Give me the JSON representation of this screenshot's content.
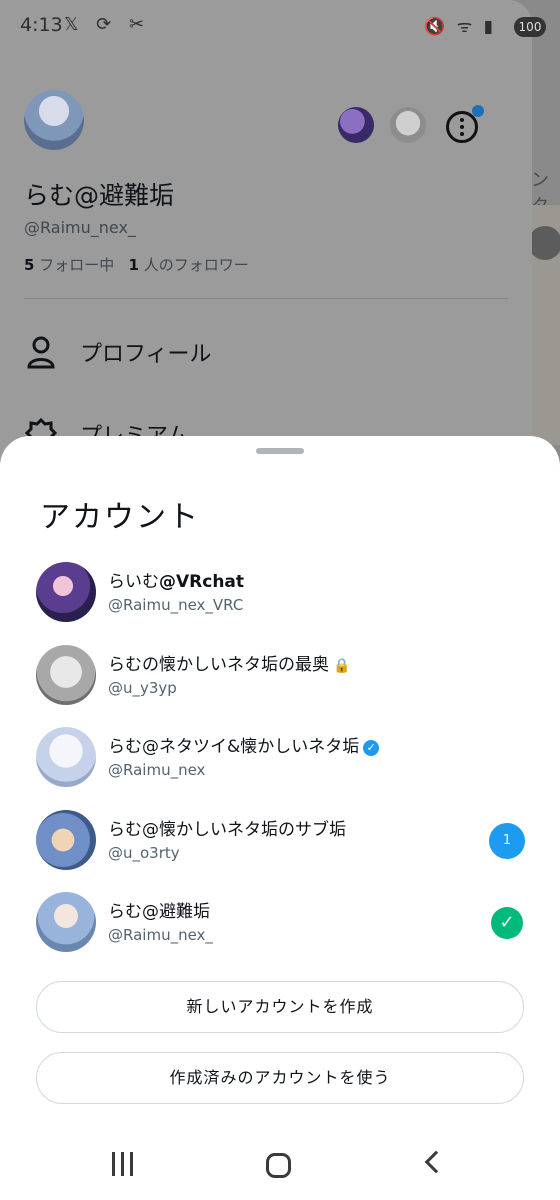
{
  "status_bar": {
    "time": "4:13",
    "left_icons": "𝕏 ⟳ ✂",
    "right_icons": "🔇 ᯤ ▮",
    "battery": "100"
  },
  "drawer": {
    "display_name": "らむ@避難垢",
    "handle": "@Raimu_nex_",
    "following_count": "5",
    "following_label": "フォロー中",
    "followers_count": "1",
    "followers_label": "人のフォロワー",
    "menu": [
      {
        "label": "プロフィール",
        "icon": "person-icon"
      },
      {
        "label": "プレミアム",
        "icon": "premium-icon"
      }
    ]
  },
  "background": {
    "partial_text": "ンタ"
  },
  "sheet": {
    "title": "アカウント",
    "accounts": [
      {
        "name_pre": "らいむ",
        "name_bold": "@VRchat",
        "handle": "@Raimu_nex_VRC"
      },
      {
        "name": "らむの懐かしいネタ垢の最奥",
        "lock": "🔒",
        "handle": "@u_y3yp"
      },
      {
        "name": "らむ@ネタツイ&懐かしいネタ垢",
        "verified": "✓",
        "handle": "@Raimu_nex"
      },
      {
        "name": "らむ@懐かしいネタ垢のサブ垢",
        "handle": "@u_o3rty",
        "badge": "1"
      },
      {
        "name": "らむ@避難垢",
        "handle": "@Raimu_nex_",
        "check": "✓"
      }
    ],
    "create_button": "新しいアカウントを作成",
    "use_existing_button": "作成済みのアカウントを使う"
  },
  "colors": {
    "accent": "#1d9bf0",
    "success": "#00ba7c",
    "handle_text": "#536471"
  }
}
